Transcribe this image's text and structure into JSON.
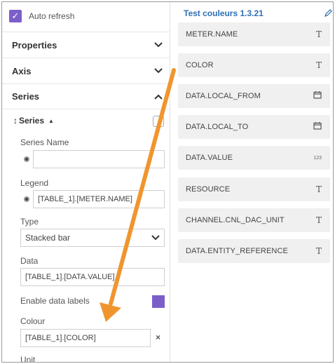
{
  "left_panel": {
    "auto_refresh_label": "Auto refresh",
    "sections": [
      {
        "title": "Properties",
        "state": "collapsed"
      },
      {
        "title": "Axis",
        "state": "collapsed"
      },
      {
        "title": "Series",
        "state": "expanded"
      }
    ],
    "series_sub_title": "Series",
    "series_name": {
      "label": "Series Name",
      "value": ""
    },
    "legend": {
      "label": "Legend",
      "value": "[TABLE_1].[METER.NAME]"
    },
    "type": {
      "label": "Type",
      "value": "Stacked bar"
    },
    "data": {
      "label": "Data",
      "value": "[TABLE_1].[DATA.VALUE]"
    },
    "enable_data_labels": {
      "label": "Enable data labels",
      "color": "#7b5fc9"
    },
    "colour": {
      "label": "Colour",
      "value": "[TABLE_1].[COLOR]"
    },
    "unit_label": "Unit"
  },
  "right_panel": {
    "title": "Test couleurs 1.3.21",
    "fields": [
      {
        "name": "METER.NAME",
        "type_icon": "T"
      },
      {
        "name": "COLOR",
        "type_icon": "T"
      },
      {
        "name": "DATA.LOCAL_FROM",
        "type_icon": "calendar"
      },
      {
        "name": "DATA.LOCAL_TO",
        "type_icon": "calendar"
      },
      {
        "name": "DATA.VALUE",
        "type_icon": "123"
      },
      {
        "name": "RESOURCE",
        "type_icon": "T"
      },
      {
        "name": "CHANNEL.CNL_DAC_UNIT",
        "type_icon": "T"
      },
      {
        "name": "DATA.ENTITY_REFERENCE",
        "type_icon": "T"
      }
    ]
  },
  "colors": {
    "accent": "#7b5fc9",
    "title_blue": "#2f6fb5",
    "annotation_arrow": "#f0952e"
  }
}
